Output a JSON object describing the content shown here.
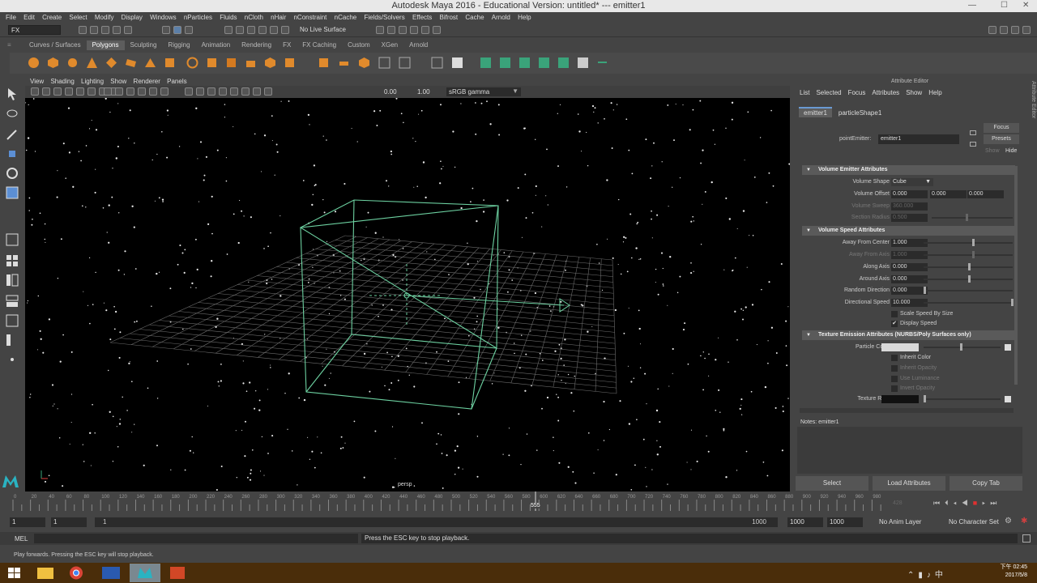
{
  "window": {
    "title": "Autodesk Maya 2016 - Educational Version: untitled*   ---   emitter1",
    "minimize": "—",
    "maximize": "☐",
    "close": "✕"
  },
  "menubar": [
    "File",
    "Edit",
    "Create",
    "Select",
    "Modify",
    "Display",
    "Windows",
    "nParticles",
    "Fluids",
    "nCloth",
    "nHair",
    "nConstraint",
    "nCache",
    "Fields/Solvers",
    "Effects",
    "Bifrost",
    "Cache",
    "Arnold",
    "Help"
  ],
  "statusline": {
    "mode": "FX",
    "live_surface": "No Live Surface"
  },
  "shelf": {
    "tabs": [
      "Curves / Surfaces",
      "Polygons",
      "Sculpting",
      "Rigging",
      "Animation",
      "Rendering",
      "FX",
      "FX Caching",
      "Custom",
      "XGen",
      "Arnold"
    ],
    "active_tab": "Polygons"
  },
  "viewport": {
    "menu": [
      "View",
      "Shading",
      "Lighting",
      "Show",
      "Renderer",
      "Panels"
    ],
    "exposure": "0.00",
    "gamma": "1.00",
    "color_space": "sRGB gamma",
    "camera_label": "persp"
  },
  "attribute_editor": {
    "header": "Attribute Editor",
    "menu": [
      "List",
      "Selected",
      "Focus",
      "Attributes",
      "Show",
      "Help"
    ],
    "tabs": [
      "emitter1",
      "particleShape1"
    ],
    "active_tab": "emitter1",
    "node_label": "pointEmitter:",
    "node_name": "emitter1",
    "focus_button": "Focus",
    "presets_button": "Presets",
    "show_label": "Show",
    "hide_label": "Hide",
    "sections": {
      "volume_emitter": "Volume Emitter Attributes",
      "volume_speed": "Volume Speed Attributes",
      "texture_emission": "Texture Emission Attributes (NURBS/Poly Surfaces only)"
    },
    "volume_shape_label": "Volume Shape",
    "volume_shape": "Cube",
    "volume_offset_label": "Volume Offset",
    "volume_offset": [
      "0.000",
      "0.000",
      "0.000"
    ],
    "volume_sweep_label": "Volume Sweep",
    "volume_sweep": "360.000",
    "section_radius_label": "Section Radius",
    "section_radius": "0.500",
    "away_from_center_label": "Away From Center",
    "away_from_center": "1.000",
    "away_from_axis_label": "Away From Axis",
    "away_from_axis": "1.000",
    "along_axis_label": "Along Axis",
    "along_axis": "0.000",
    "around_axis_label": "Around Axis",
    "around_axis": "0.000",
    "random_direction_label": "Random Direction",
    "random_direction": "0.000",
    "directional_speed_label": "Directional Speed",
    "directional_speed": "10.000",
    "scale_speed_by_size": "Scale Speed By Size",
    "display_speed": "Display Speed",
    "display_speed_checked": "✔",
    "particle_color_label": "Particle Color",
    "inherit_color": "Inherit Color",
    "inherit_opacity": "Inherit Opacity",
    "use_luminance": "Use Luminance",
    "invert_opacity": "Invert Opacity",
    "texture_rate_label": "Texture Rate",
    "notes_label": "Notes: emitter1",
    "buttons": [
      "Select",
      "Load Attributes",
      "Copy Tab"
    ]
  },
  "timeline": {
    "ticks": [
      "0",
      "20",
      "40",
      "60",
      "80",
      "100",
      "120",
      "140",
      "160",
      "180",
      "200",
      "220",
      "240",
      "260",
      "280",
      "300",
      "320",
      "340",
      "360",
      "380",
      "400",
      "420",
      "440",
      "460",
      "480",
      "500",
      "520",
      "540",
      "560",
      "580",
      "600",
      "620",
      "640",
      "660",
      "680",
      "700",
      "720",
      "740",
      "760",
      "780",
      "800",
      "820",
      "840",
      "860",
      "880",
      "900",
      "920",
      "940",
      "960",
      "980"
    ],
    "current_frame": "555",
    "end_frame_dim": "428"
  },
  "range": {
    "start": "1",
    "playback_start": "1",
    "slider_start": "1",
    "slider_end": "1000",
    "playback_end": "1000",
    "end": "1000",
    "anim_layer": "No Anim Layer",
    "character_set": "No Character Set"
  },
  "commandline": {
    "mode": "MEL",
    "message": "Press the ESC key to stop playback."
  },
  "helpline": "Play forwards. Pressing the ESC key will stop playback.",
  "taskbar": {
    "time": "下午 02:45",
    "date": "2017/5/8"
  }
}
